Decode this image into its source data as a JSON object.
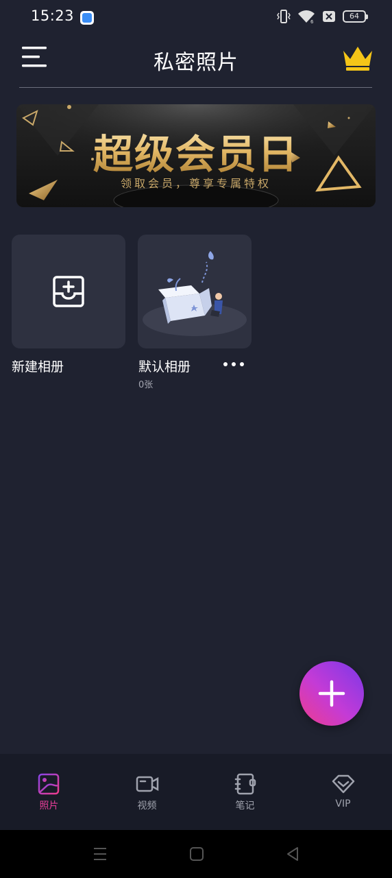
{
  "status_bar": {
    "time": "15:23",
    "battery": "64"
  },
  "header": {
    "title": "私密照片",
    "menu_icon": "hamburger-menu-icon",
    "vip_icon": "crown-icon"
  },
  "banner": {
    "title": "超级会员日",
    "subtitle": "领取会员，尊享专属特权"
  },
  "albums": [
    {
      "name": "新建相册",
      "icon": "add-album-icon"
    },
    {
      "name": "默认相册",
      "count": "0张"
    }
  ],
  "bottom_nav": {
    "items": [
      {
        "label": "照片",
        "icon": "photo-icon",
        "active": true
      },
      {
        "label": "视频",
        "icon": "video-icon",
        "active": false
      },
      {
        "label": "笔记",
        "icon": "notebook-icon",
        "active": false
      },
      {
        "label": "VIP",
        "icon": "diamond-icon",
        "active": false
      }
    ]
  },
  "colors": {
    "background": "#1f2230",
    "card": "#2e3140",
    "accent": "#e43d97",
    "fab_start": "#7b38e8",
    "fab_end": "#ee3c8d",
    "gold": "#f5c518"
  }
}
